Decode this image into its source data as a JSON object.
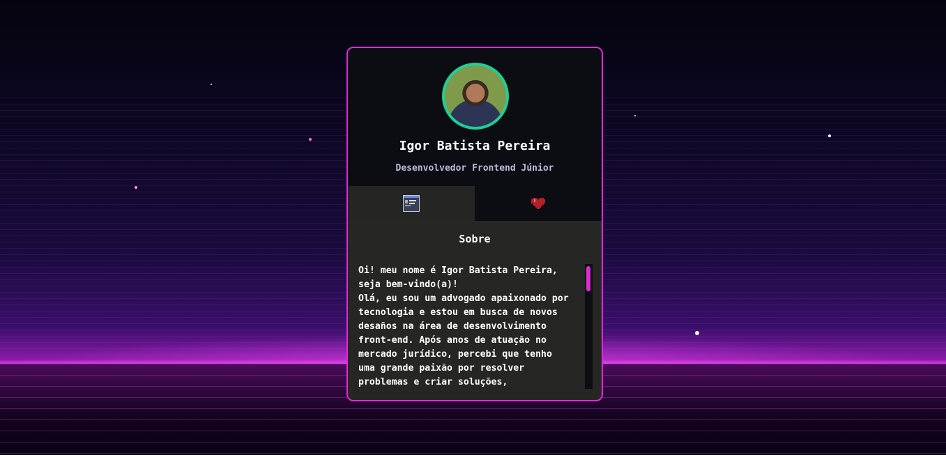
{
  "profile": {
    "name": "Igor Batista Pereira",
    "role": "Desenvolvedor Frontend Júnior"
  },
  "tabs": [
    {
      "icon": "about-window-icon",
      "active": true
    },
    {
      "icon": "heart-icon",
      "active": false
    }
  ],
  "about": {
    "title": "Sobre",
    "lines": [
      "Oi! meu nome é Igor Batista Pereira,",
      "seja bem-vindo(a)!",
      "Olá, eu sou um advogado apaixonado por",
      "tecnologia e estou em busca de novos",
      "desaños na área de desenvolvimento",
      "front-end. Após anos de atuação no",
      "mercado jurídico, percebi que tenho",
      "uma grande paixão por resolver",
      "problemas e criar soluções,"
    ],
    "scroll_position": 0
  },
  "colors": {
    "accent": "#e02ad8",
    "avatar_border": "#1fcf95",
    "card_header": "#0b0d12",
    "card_body": "#262624"
  }
}
